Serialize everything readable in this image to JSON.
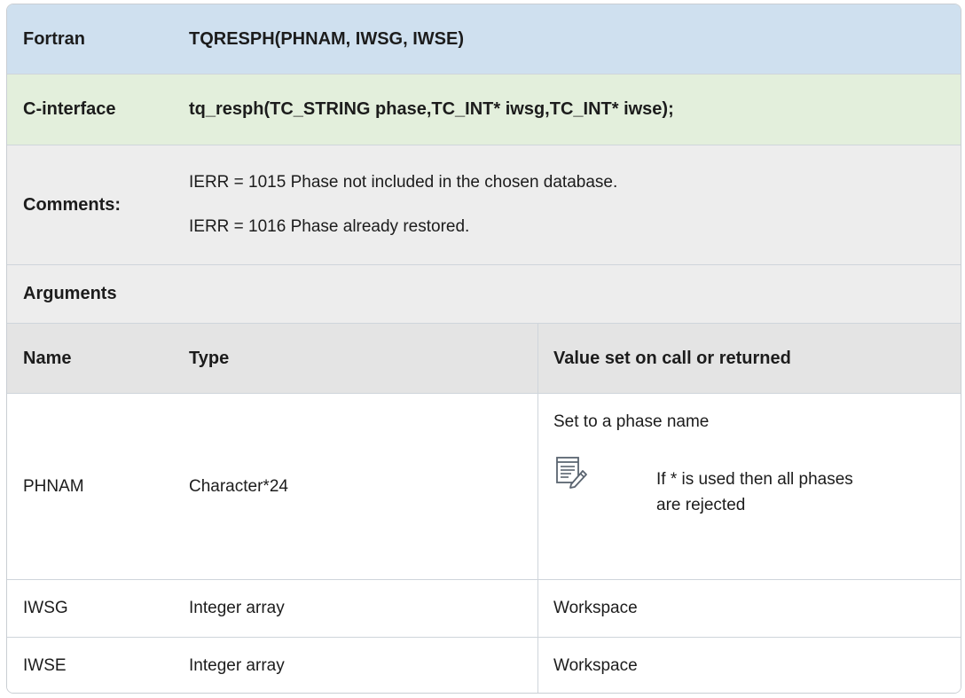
{
  "fortran": {
    "label": "Fortran",
    "signature": "TQRESPH(PHNAM, IWSG, IWSE)"
  },
  "c_interface": {
    "label": "C-interface",
    "signature": "tq_resph(TC_STRING phase,TC_INT* iwsg,TC_INT* iwse);"
  },
  "comments": {
    "label": "Comments:",
    "lines": [
      "IERR = 1015 Phase not included in the chosen database.",
      "IERR = 1016 Phase already restored."
    ]
  },
  "arguments": {
    "title": "Arguments",
    "columns": [
      "Name",
      "Type",
      "Value set on call or returned"
    ],
    "rows": [
      {
        "name": "PHNAM",
        "type": "Character*24",
        "value": "Set to a phase name",
        "note": {
          "icon": "note-edit-icon",
          "text": "If * is used then all phases are rejected"
        }
      },
      {
        "name": "IWSG",
        "type": "Integer array",
        "value": "Workspace"
      },
      {
        "name": "IWSE",
        "type": "Integer array",
        "value": "Workspace"
      }
    ]
  },
  "colors": {
    "fortran_bg": "#cfe0ef",
    "c_interface_bg": "#e3efdc",
    "comments_bg": "#ededed",
    "header_bg": "#e4e4e4",
    "border": "#cfd5db"
  }
}
